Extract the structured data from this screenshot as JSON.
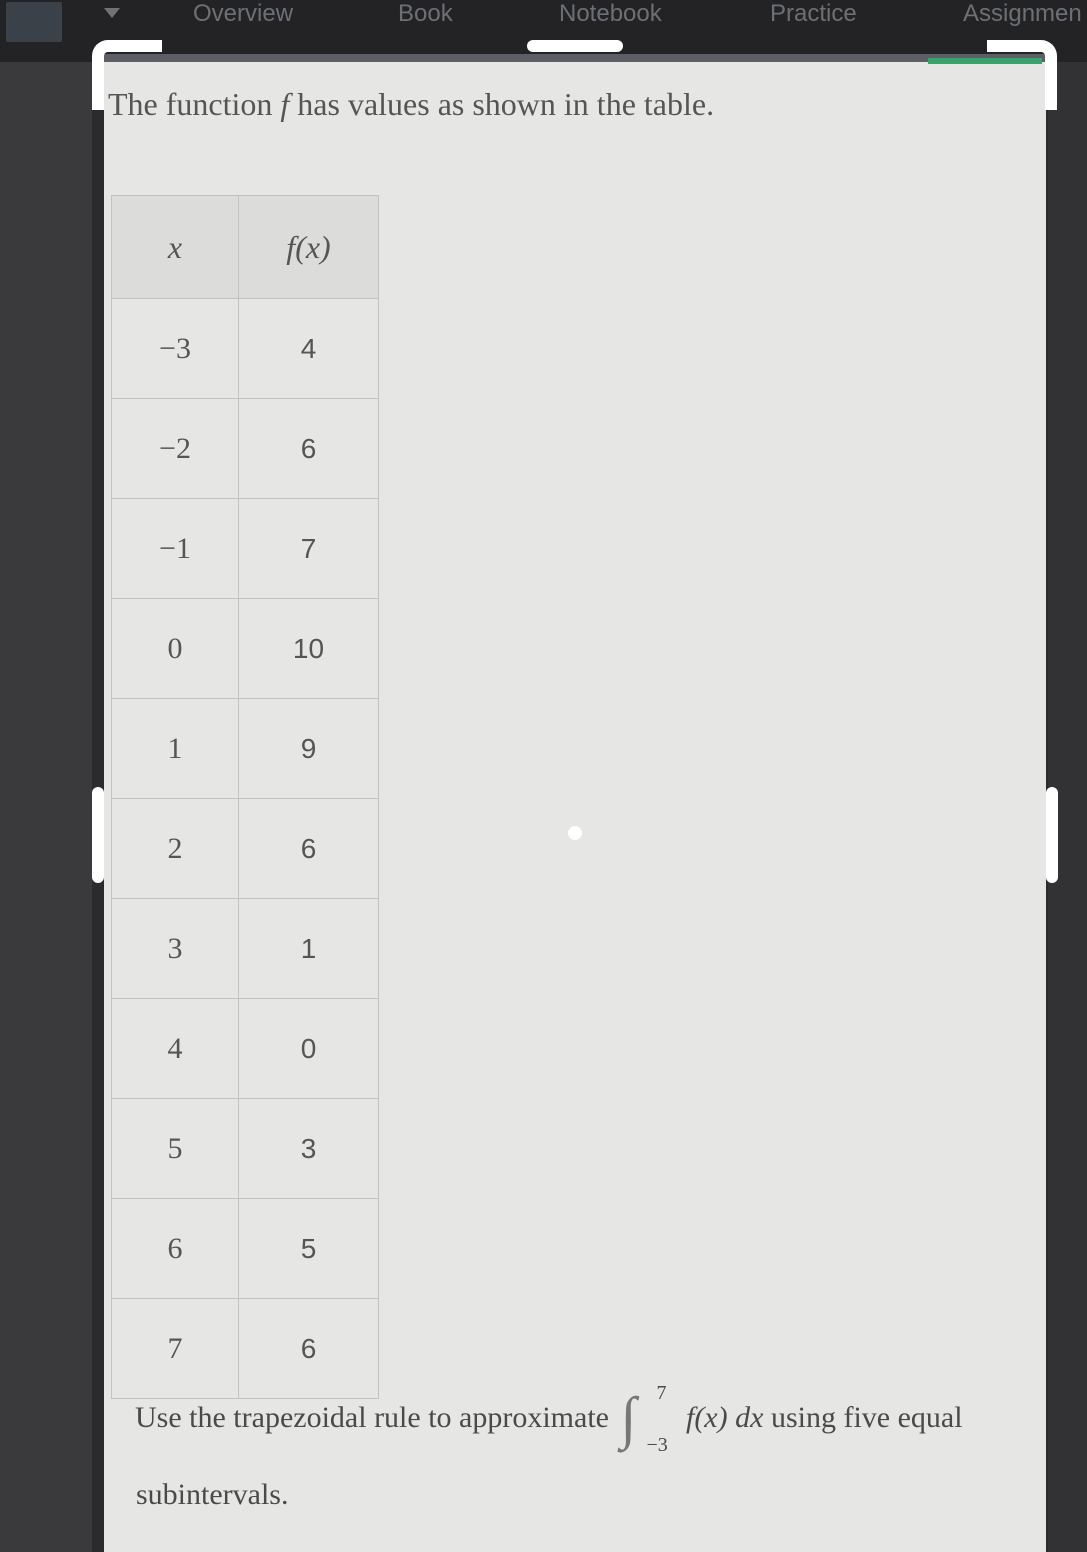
{
  "tabs": [
    {
      "label": "Overview"
    },
    {
      "label": "Book"
    },
    {
      "label": "Notebook"
    },
    {
      "label": "Practice"
    },
    {
      "label": "Assignmen"
    }
  ],
  "question": {
    "prefix": "The function ",
    "var": "f",
    "suffix": " has values as shown in the table."
  },
  "table": {
    "headers": [
      "x",
      "f(x)"
    ],
    "rows": [
      {
        "x": "−3",
        "fx": "4"
      },
      {
        "x": "−2",
        "fx": "6"
      },
      {
        "x": "−1",
        "fx": "7"
      },
      {
        "x": "0",
        "fx": "10"
      },
      {
        "x": "1",
        "fx": "9"
      },
      {
        "x": "2",
        "fx": "6"
      },
      {
        "x": "3",
        "fx": "1"
      },
      {
        "x": "4",
        "fx": "0"
      },
      {
        "x": "5",
        "fx": "3"
      },
      {
        "x": "6",
        "fx": "5"
      },
      {
        "x": "7",
        "fx": "6"
      }
    ]
  },
  "prompt": {
    "lead": "Use the trapezoidal rule to approximate",
    "upper": "7",
    "lower": "−3",
    "integrand": "f(x) dx",
    "tail": " using five equal",
    "line2": "subintervals."
  },
  "colors": {
    "content_bg": "#e6e6e4",
    "accent": "#3aa36c"
  }
}
